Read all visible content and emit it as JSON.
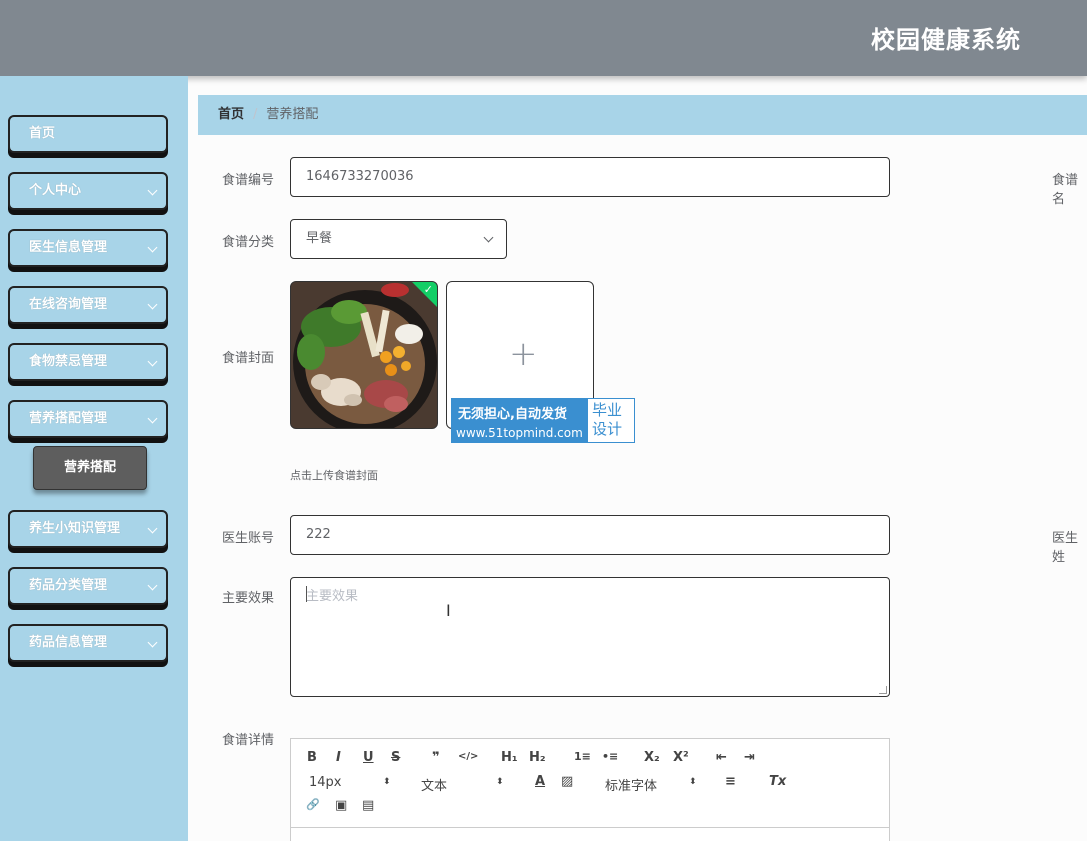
{
  "header": {
    "title": "校园健康系统"
  },
  "sidebar": {
    "items": [
      {
        "label": "首页"
      },
      {
        "label": "个人中心"
      },
      {
        "label": "医生信息管理"
      },
      {
        "label": "在线咨询管理"
      },
      {
        "label": "食物禁忌管理"
      },
      {
        "label": "营养搭配管理"
      },
      {
        "label": "养生小知识管理"
      },
      {
        "label": "药品分类管理"
      },
      {
        "label": "药品信息管理"
      }
    ],
    "active_sub": {
      "label": "营养搭配"
    }
  },
  "breadcrumb": {
    "home": "首页",
    "separator": "/",
    "current": "营养搭配"
  },
  "form": {
    "recipe_no": {
      "label": "食谱编号",
      "value": "1646733270036"
    },
    "recipe_name": {
      "label": "食谱名"
    },
    "category": {
      "label": "食谱分类",
      "value": "早餐"
    },
    "cover": {
      "label": "食谱封面",
      "tip": "点击上传食谱封面",
      "plus": "+"
    },
    "doctor_account": {
      "label": "医生账号",
      "value": "222"
    },
    "doctor_name": {
      "label": "医生姓"
    },
    "main_effect": {
      "label": "主要效果",
      "placeholder": "主要效果"
    },
    "details": {
      "label": "食谱详情"
    }
  },
  "watermark": {
    "line1": "无须担心,自动发货",
    "line2": "www.51topmind.com",
    "right": "毕业设计"
  },
  "editor_toolbar": {
    "bold": "B",
    "italic": "I",
    "underline": "U",
    "strike": "S",
    "blockquote": "❞",
    "code": "</>",
    "h1": "H₁",
    "h2": "H₂",
    "ordered_list": "1≡",
    "bullet_list": "•≡",
    "subscript": "X₂",
    "superscript": "X²",
    "outdent": "⇤",
    "indent": "⇥",
    "size": "14px",
    "header": "文本",
    "font": "标准字体",
    "color": "A",
    "background": "▨",
    "align": "≡",
    "clean": "Tx",
    "link": "🔗",
    "image": "▣",
    "video": "▤"
  },
  "colors": {
    "header_bg": "#808890",
    "sidebar_bg": "#a8d4e8",
    "accent": "#3a8fd0",
    "success": "#13ce66"
  }
}
